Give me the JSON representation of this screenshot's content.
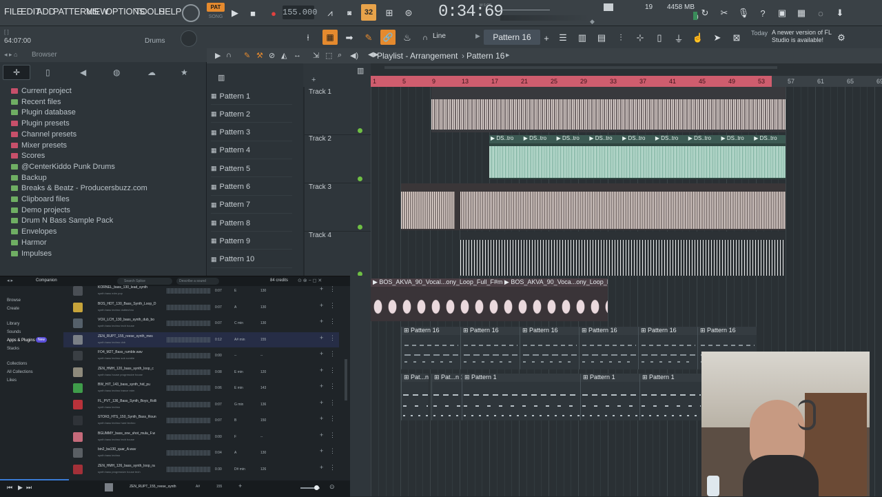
{
  "menu": [
    "FILE",
    "EDIT",
    "ADD",
    "PATTERNS",
    "VIEW",
    "OPTIONS",
    "TOOLS",
    "HELP"
  ],
  "transport": {
    "pat_label": "PAT",
    "song_label": "SONG",
    "tempo": "155.000",
    "time": "0:34:69",
    "time_unit": "M:S:CS",
    "step_label": "32"
  },
  "stats": {
    "cpu_voices": "19",
    "memory": "4458 MB",
    "zero": "0"
  },
  "update_notice": {
    "prefix": "Today",
    "text": "A newer version of FL Studio is available!"
  },
  "hint": {
    "time": "64:07:00",
    "channel": "Drums"
  },
  "playlist": {
    "snap_label": "Line",
    "current_pattern": "Pattern 16",
    "title": "Playlist - Arrangement",
    "pattern_crumb": "Pattern 16"
  },
  "browser": {
    "title": "Browser",
    "items": [
      {
        "label": "Current project",
        "color": "#c7506a"
      },
      {
        "label": "Recent files",
        "color": "#6fae63"
      },
      {
        "label": "Plugin database",
        "color": "#6fae63"
      },
      {
        "label": "Plugin presets",
        "color": "#c7506a"
      },
      {
        "label": "Channel presets",
        "color": "#c7506a"
      },
      {
        "label": "Mixer presets",
        "color": "#c7506a"
      },
      {
        "label": "Scores",
        "color": "#c7506a"
      },
      {
        "label": "@CenterKiddo Punk Drums",
        "color": "#6fae63"
      },
      {
        "label": "Backup",
        "color": "#6fae63"
      },
      {
        "label": "Breaks & Beatz - Producersbuzz.com",
        "color": "#6fae63"
      },
      {
        "label": "Clipboard files",
        "color": "#6fae63"
      },
      {
        "label": "Demo projects",
        "color": "#6fae63"
      },
      {
        "label": "Drum N Bass Sample Pack",
        "color": "#6fae63"
      },
      {
        "label": "Envelopes",
        "color": "#6fae63"
      },
      {
        "label": "Harmor",
        "color": "#6fae63"
      },
      {
        "label": "Impulses",
        "color": "#6fae63"
      }
    ]
  },
  "patterns": [
    "Pattern 1",
    "Pattern 2",
    "Pattern 3",
    "Pattern 4",
    "Pattern 5",
    "Pattern 6",
    "Pattern 7",
    "Pattern 8",
    "Pattern 9",
    "Pattern 10"
  ],
  "tracks": [
    "Track 1",
    "Track 2",
    "Track 3",
    "Track 4"
  ],
  "ruler": [
    "1",
    "5",
    "9",
    "13",
    "17",
    "21",
    "25",
    "29",
    "33",
    "37",
    "41",
    "45",
    "49",
    "53",
    "57",
    "61",
    "65",
    "69"
  ],
  "clips": {
    "track2_label": "DS..tro",
    "vocal_label": "BOS_AKVA_90_Vocal...ony_Loop_Full_F#m",
    "vocal_label2": "BOS_AKVA_90_Voca...ony_Loop_Full_F#m",
    "pattern16": "Pattern 16",
    "pattern1": "Pattern 1",
    "pat_short": "Pat...n 1"
  },
  "companion": {
    "title": "Companion",
    "search_placeholder": "Search Splice",
    "describe_placeholder": "Describe a sound",
    "credits": "84 credits",
    "nav": [
      "Browse",
      "Create",
      "Library",
      "Sounds",
      "Apps & Plugins",
      "Stacks",
      "Collections",
      "All Collections",
      "Likes"
    ],
    "new_badge": "New",
    "rows": [
      {
        "name": "KORNEL_bass_130_lead_synth",
        "tags": "synth  bass  edm  pop",
        "time": "0:07",
        "key": "E",
        "bpm": "130",
        "color": "#4a4f55"
      },
      {
        "name": "BOS_HDT_130_Bass_Synth_Loop_D",
        "tags": "synth  bass  techno  dubtechno",
        "time": "0:07",
        "key": "A",
        "bpm": "130",
        "color": "#c7a43a"
      },
      {
        "name": "VOX_LCH_130_bass_synth_dub_bo",
        "tags": "synth  bass  techno  tech house",
        "time": "0:07",
        "key": "C min",
        "bpm": "130",
        "color": "#55606a"
      },
      {
        "name": "ZEN_RUPT_155_reese_synth_mes",
        "tags": "synth  bass  techno  dnb",
        "time": "0:12",
        "key": "A# min",
        "bpm": "155",
        "color": "#7a7f86"
      },
      {
        "name": "FO4_M2T_Bass_rumble.wav",
        "tags": "synth  bass  techno  sub  rumble",
        "time": "0:00",
        "key": "--",
        "bpm": "--",
        "color": "#3a3f44"
      },
      {
        "name": "ZEN_HMH_120_bass_synth_loop_c",
        "tags": "synth  bass  house  progressive house",
        "time": "0:08",
        "key": "E min",
        "bpm": "120",
        "color": "#8e8a7c"
      },
      {
        "name": "BW_HIT_143_bass_synth_hid_pu",
        "tags": "synth  bass  techno  trance  edm",
        "time": "0:06",
        "key": "E min",
        "bpm": "143",
        "color": "#3f9c4a"
      },
      {
        "name": "FL_PVT_136_Bass_Synth_Boys_Rolli",
        "tags": "synth  bass  techno",
        "time": "0:07",
        "key": "G min",
        "bpm": "136",
        "color": "#b8323a"
      },
      {
        "name": "STOR3_HTS_150_Synth_Bass_Roun",
        "tags": "synth  bass  techno  hard techno",
        "time": "0:07",
        "key": "B",
        "bpm": "150",
        "color": "#2f3338"
      },
      {
        "name": "BGUMMY_bass_one_shot_mula_F.w",
        "tags": "synth  bass  techno  tech house",
        "time": "0:00",
        "key": "F",
        "bpm": "--",
        "color": "#c56a7a"
      },
      {
        "name": "bin2_ba130_quar_A.wav",
        "tags": "synth  bass  techno",
        "time": "0:04",
        "key": "A",
        "bpm": "130",
        "color": "#5a5f64"
      },
      {
        "name": "ZEN_HMH_126_bass_synth_loop_ra",
        "tags": "synth  bass  progressive house  tech",
        "time": "0:30",
        "key": "D# min",
        "bpm": "126",
        "color": "#a33038"
      }
    ],
    "player_name": "ZEN_RUPT_155_reese_synth",
    "player_key": "A#",
    "player_bpm": "155"
  }
}
